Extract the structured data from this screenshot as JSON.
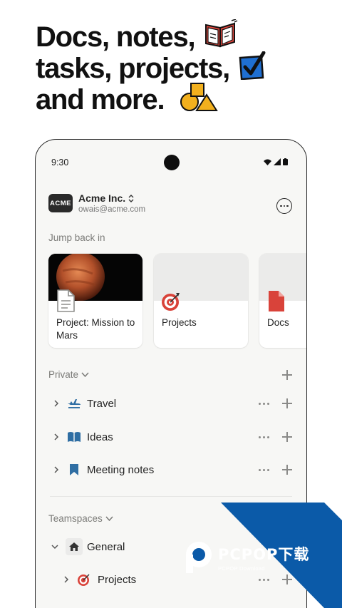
{
  "headline": {
    "line1": "Docs, notes,",
    "line2": "tasks, projects,",
    "line3": "and more."
  },
  "status_bar": {
    "time": "9:30"
  },
  "workspace": {
    "logo_text": "ACME",
    "name": "Acme Inc.",
    "email": "owais@acme.com"
  },
  "jump_back": {
    "label": "Jump back in",
    "cards": [
      {
        "title": "Project: Mission to Mars",
        "icon": "document-icon"
      },
      {
        "title": "Projects",
        "icon": "target-icon"
      },
      {
        "title": "Docs",
        "icon": "doc-red-icon"
      }
    ]
  },
  "private": {
    "label": "Private",
    "items": [
      {
        "label": "Travel",
        "icon": "airplane-icon"
      },
      {
        "label": "Ideas",
        "icon": "open-book-icon"
      },
      {
        "label": "Meeting notes",
        "icon": "bookmark-icon"
      }
    ]
  },
  "teamspaces": {
    "label": "Teamspaces",
    "items": [
      {
        "label": "General",
        "icon": "home-icon"
      },
      {
        "label": "Projects",
        "icon": "target-icon"
      }
    ]
  },
  "watermark": {
    "main": "PCPOP下载",
    "sub": "PCPOP Download"
  },
  "colors": {
    "accent_red": "#d9433a",
    "accent_blue": "#2f6ea3",
    "watermark_blue": "#0b5aa8",
    "deco_yellow": "#f2b01e"
  }
}
